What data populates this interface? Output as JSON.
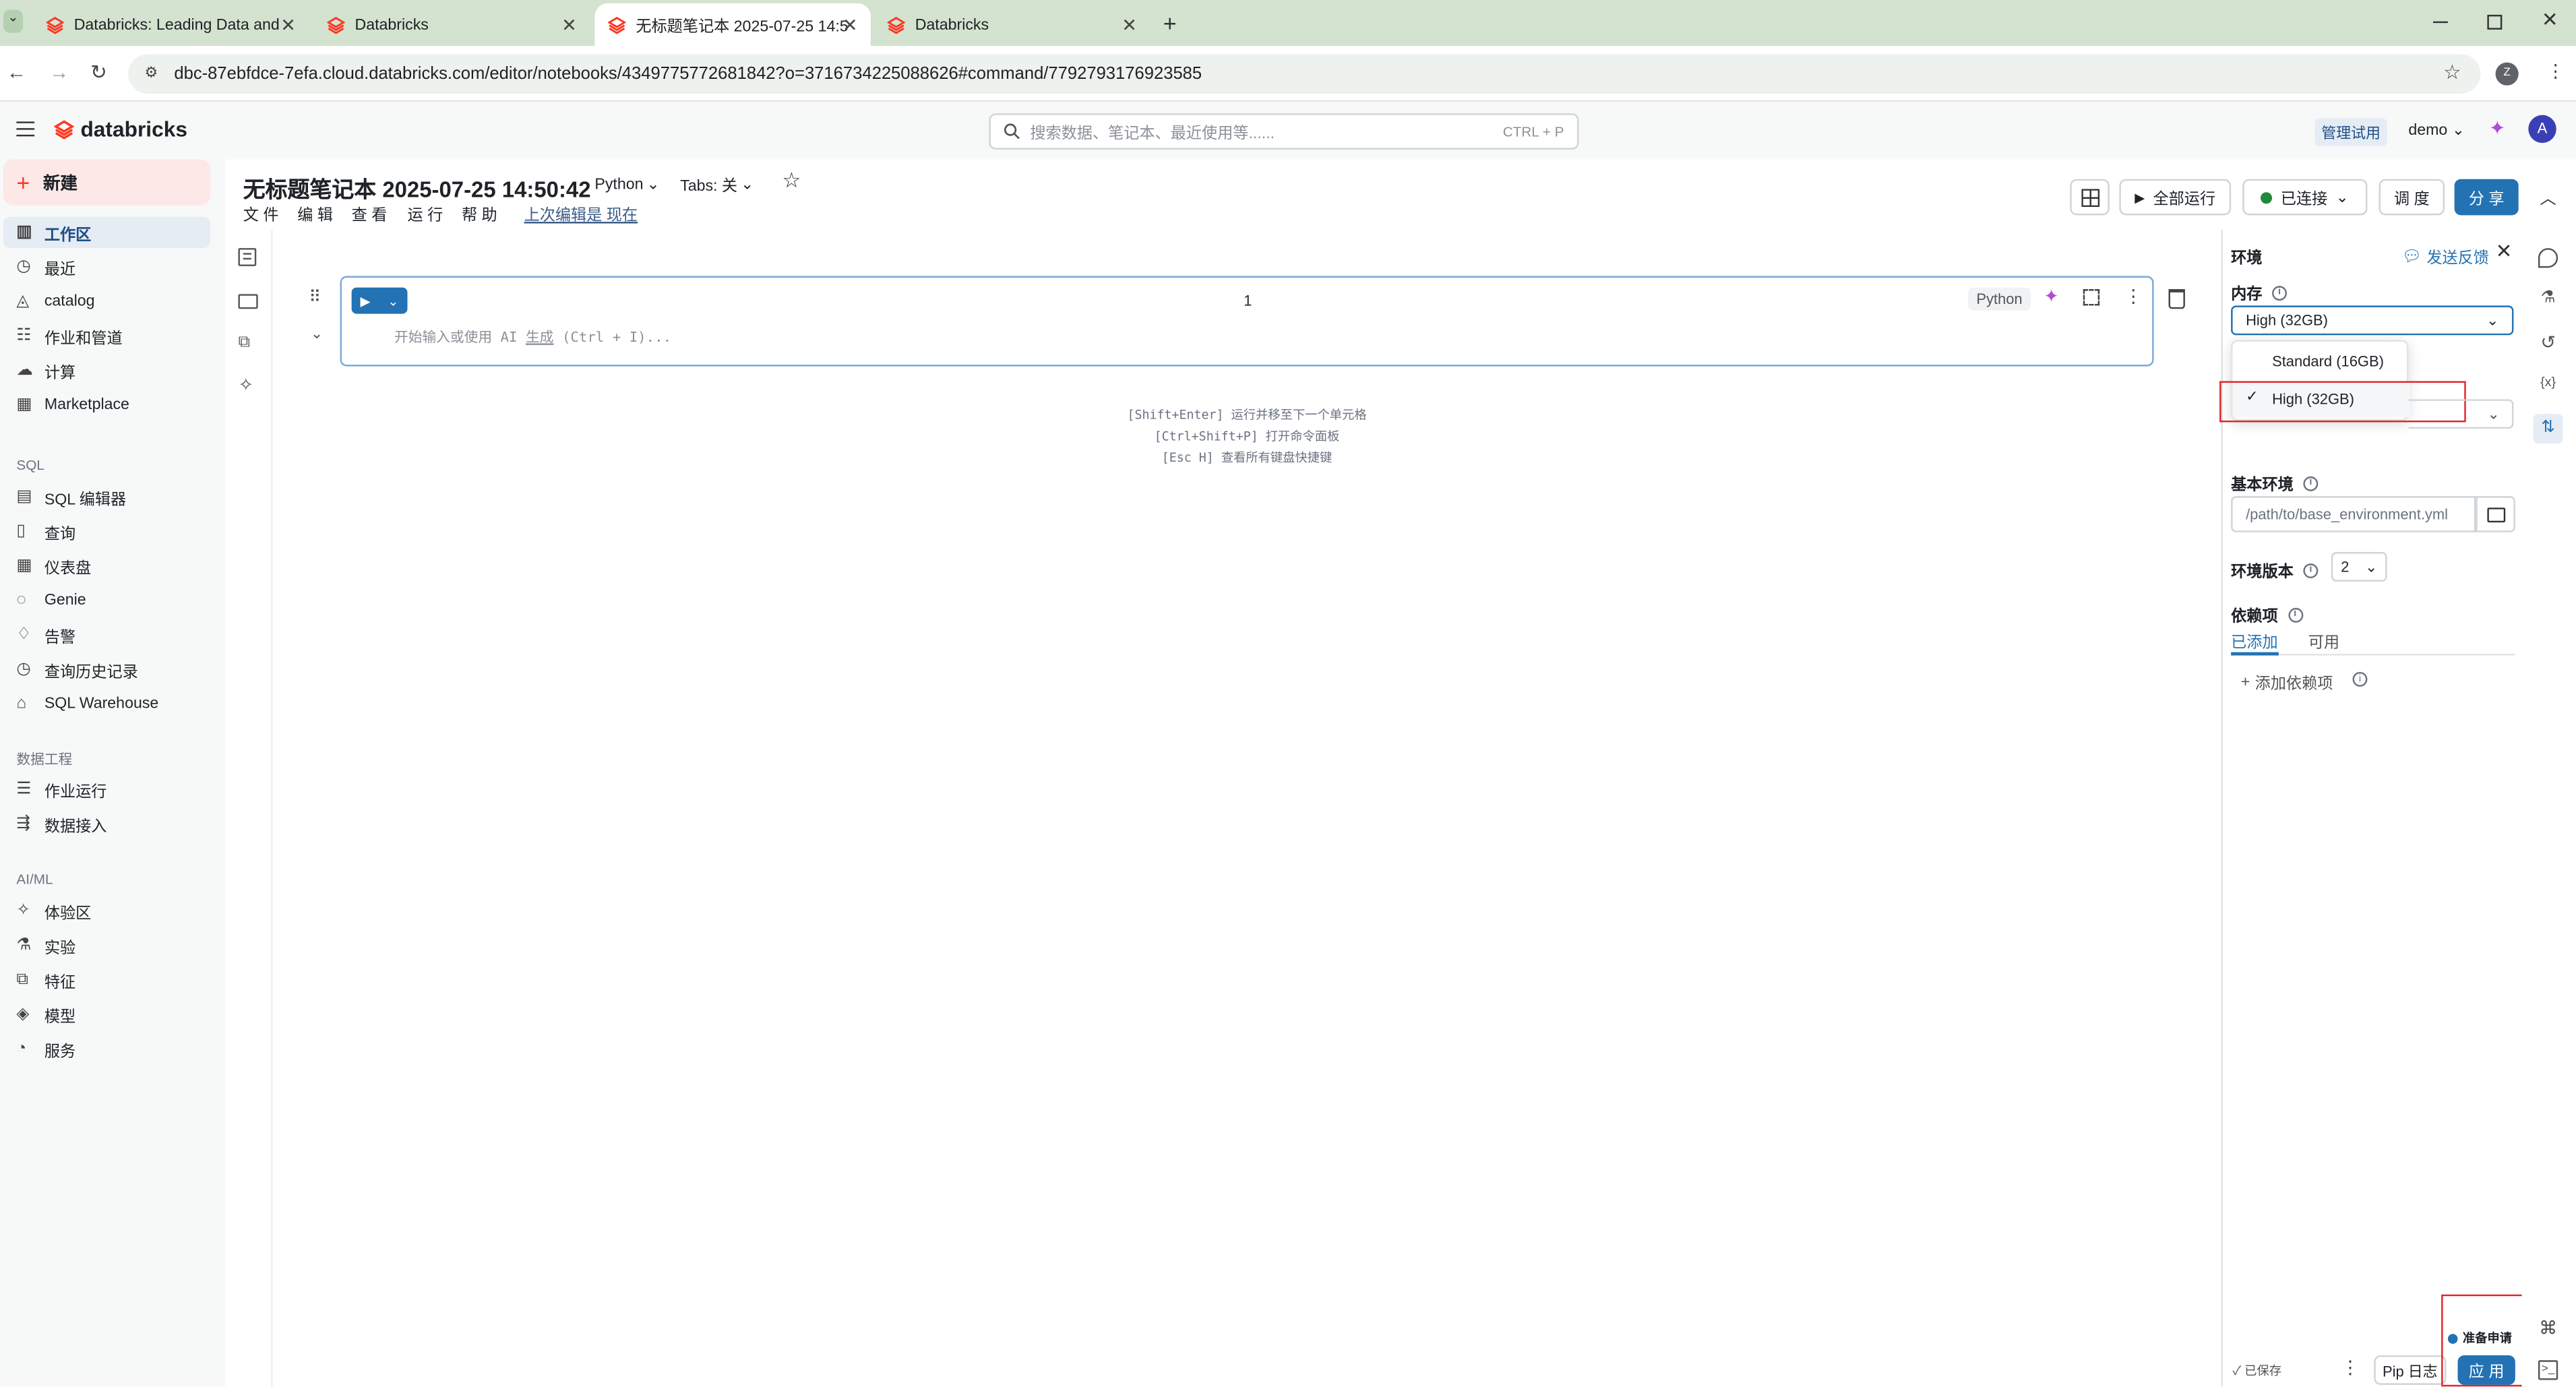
{
  "browser": {
    "tabs": [
      {
        "title": "Databricks: Leading Data and"
      },
      {
        "title": "Databricks"
      },
      {
        "title": "无标题笔记本 2025-07-25 14:5"
      },
      {
        "title": "Databricks"
      }
    ],
    "url": "dbc-87ebfdce-7efa.cloud.databricks.com/editor/notebooks/4349775772681842?o=3716734225088626#command/7792793176923585",
    "profile": "Z"
  },
  "app": {
    "logo": "databricks",
    "search_placeholder": "搜索数据、笔记本、最近使用等......",
    "search_shortcut": "CTRL + P",
    "admin_trial": "管理试用",
    "user_menu": "demo",
    "avatar": "A"
  },
  "sidebar": {
    "new_label": "新建",
    "items": [
      {
        "label": "工作区",
        "icon": "workspace-icon"
      },
      {
        "label": "最近",
        "icon": "clock-icon"
      },
      {
        "label": "catalog",
        "icon": "catalog-icon"
      },
      {
        "label": "作业和管道",
        "icon": "workflows-icon"
      },
      {
        "label": "计算",
        "icon": "cloud-icon"
      },
      {
        "label": "Marketplace",
        "icon": "marketplace-icon"
      }
    ],
    "sql_section": "SQL",
    "sql_items": [
      {
        "label": "SQL 编辑器",
        "icon": "sql-editor-icon"
      },
      {
        "label": "查询",
        "icon": "query-icon"
      },
      {
        "label": "仪表盘",
        "icon": "dashboard-icon"
      },
      {
        "label": "Genie",
        "icon": "genie-icon"
      },
      {
        "label": "告警",
        "icon": "bell-icon"
      },
      {
        "label": "查询历史记录",
        "icon": "history-icon"
      },
      {
        "label": "SQL Warehouse",
        "icon": "warehouse-icon"
      }
    ],
    "de_section": "数据工程",
    "de_items": [
      {
        "label": "作业运行",
        "icon": "job-runs-icon"
      },
      {
        "label": "数据接入",
        "icon": "ingest-icon"
      }
    ],
    "ml_section": "AI/ML",
    "ml_items": [
      {
        "label": "体验区",
        "icon": "playground-icon"
      },
      {
        "label": "实验",
        "icon": "experiment-icon"
      },
      {
        "label": "特征",
        "icon": "feature-icon"
      },
      {
        "label": "模型",
        "icon": "model-icon"
      },
      {
        "label": "服务",
        "icon": "serving-icon"
      }
    ]
  },
  "notebook": {
    "title": "无标题笔记本 2025-07-25 14:50:42",
    "language": "Python",
    "tabs_label": "Tabs: 关",
    "menus": [
      "文 件",
      "编 辑",
      "查 看",
      "运 行",
      "帮 助"
    ],
    "last_edit": "上次编辑是 现在",
    "run_all": "全部运行",
    "connected": "已连接",
    "schedule": "调 度",
    "share": "分 享",
    "cell": {
      "number": "1",
      "lang_badge": "Python",
      "placeholder_pre": "开始输入或使用 AI ",
      "placeholder_link": "生成",
      "placeholder_post": " (Ctrl + I)..."
    },
    "hints": [
      "[Shift+Enter] 运行并移至下一个单元格",
      "[Ctrl+Shift+P] 打开命令面板",
      "[Esc H] 查看所有键盘快捷键"
    ]
  },
  "env_panel": {
    "title": "环境",
    "feedback": "发送反馈",
    "memory_label": "内存",
    "memory_value": "High (32GB)",
    "options": [
      "Standard (16GB)",
      "High (32GB)"
    ],
    "selected_option": "High (32GB)",
    "base_env_label": "基本环境",
    "base_env_placeholder": "/path/to/base_environment.yml",
    "env_version_label": "环境版本",
    "env_version_value": "2",
    "deps_label": "依赖项",
    "deps_tabs": [
      "已添加",
      "可用"
    ],
    "add_dep": "添加依赖项",
    "status": "准备申请",
    "saved": "已保存",
    "pip_log": "Pip 日志",
    "apply": "应 用"
  },
  "colors": {
    "brand": "#ff3621",
    "primary": "#2272b4",
    "highlight": "#e0242b",
    "tabstrip": "#d3e3d0"
  }
}
